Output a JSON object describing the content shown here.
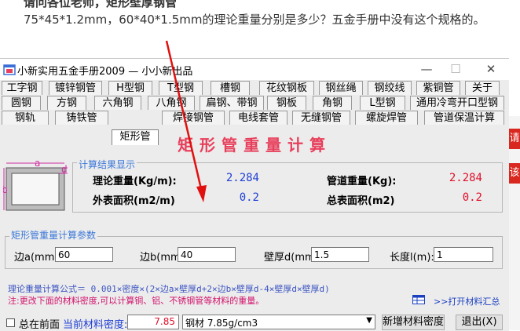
{
  "question": {
    "cut_line": "请问各位老师，矩形壁厚钢管",
    "text": "75*45*1.2mm，60*40*1.5mm的理论重量分别是多少？五金手册中没有这个规格的。"
  },
  "side_badges": [
    "请",
    "该"
  ],
  "window": {
    "title": "小新实用五金手册2009 — 小小新出品",
    "controls": {
      "minimize": "—",
      "maximize": "☐",
      "close": "✕"
    }
  },
  "tabs": {
    "row1": [
      "工字钢",
      "镀锌钢管",
      "H型钢",
      "T型钢",
      "槽钢",
      "花纹钢板",
      "钢丝绳",
      "钢绞线",
      "紫铜管",
      "关于"
    ],
    "row2": [
      "圆钢",
      "方钢",
      "六角钢",
      "八角钢",
      "扁钢、带钢",
      "钢板",
      "角钢",
      "L型钢",
      "通用冷弯开口型钢"
    ],
    "row3": [
      "钢轨",
      "铸铁管",
      "矩形管",
      "焊接钢管",
      "电线套管",
      "无缝钢管",
      "螺旋焊管",
      "管道保温计算"
    ],
    "active": "矩形管"
  },
  "heading": "矩形管重量计算",
  "diagram": {
    "label_a": "a",
    "label_b": "b",
    "label_d": "d"
  },
  "results": {
    "group_title": "计算结果显示",
    "theory_weight_label": "理论重量(Kg/m):",
    "theory_weight_value": "2.284",
    "pipe_weight_label": "管道重量(Kg):",
    "pipe_weight_value": "2.284",
    "outer_area_label": "外表面积(m2/m)",
    "outer_area_value": "0.2",
    "total_area_label": "总表面积(m2)",
    "total_area_value": "0.2"
  },
  "params": {
    "group_title": "矩形管重量计算参数",
    "side_a_label": "边a(mm):",
    "side_a_value": "60",
    "side_b_label": "边b(mm):",
    "side_b_value": "40",
    "wall_label": "壁厚d(mm)",
    "wall_value": "1.5",
    "length_label": "长度l(m):",
    "length_value": "1"
  },
  "formula": "理论重量计算公式＝ 0.001×密度×(2×边a×壁厚d+2×边b×壁厚d-4×壁厚d×壁厚d)",
  "note": "注:更改下面的材料密度,可以计算铜、铝、不锈钢管等材料的重量。",
  "open_materials": ">>打开材料汇总",
  "bottom": {
    "always_on_top": "总在前面",
    "density_label": "当前材料密度:",
    "density_value": "7.85",
    "material_select": "钢材 7.85g/cm3",
    "new_density_button": "新增材料密度",
    "exit_button": "退出(X)"
  },
  "colors": {
    "heading": "#e8405c",
    "value_blue": "#1f3fd6",
    "value_red": "#e0102a",
    "group_title": "#3c78d8",
    "arrow": "#e01010"
  }
}
